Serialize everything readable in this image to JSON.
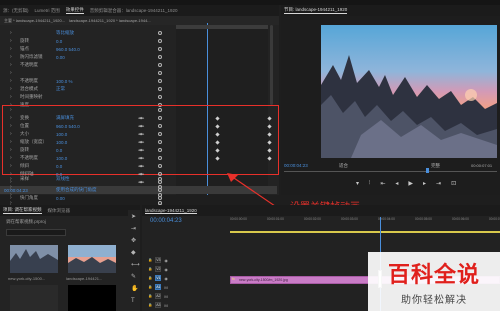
{
  "top_strip": {
    "text": "源：(无剪辑)"
  },
  "source_tabs": [
    "源：(无剪辑)",
    "Lumetri 范围",
    "效果控件",
    "音频剪辑混合器：landscape-1944211_1920"
  ],
  "effect_controls": {
    "clip_label": "主要 * landscape-1944211_1920...",
    "seq_label": "landscape-1944211_1920 * landscape-1944...",
    "rows_upper": [
      {
        "label": "",
        "value": "等比缩放",
        "checkbox": true
      },
      {
        "label": "旋转",
        "value": "0.0"
      },
      {
        "label": "锚点",
        "value": "960.0    540.0"
      },
      {
        "label": "防闪烁滤镜",
        "value": "0.00"
      },
      {
        "label": "不透明度",
        "value": ""
      },
      {
        "label": "",
        "value": ""
      },
      {
        "label": "不透明度",
        "value": "100.0 %"
      },
      {
        "label": "混合模式",
        "value": "正常"
      },
      {
        "label": "时间重映射",
        "value": ""
      },
      {
        "label": "速度",
        "value": ""
      }
    ],
    "rows_boxed": [
      {
        "label": "",
        "value": ""
      },
      {
        "label": "变换",
        "value": "满屏填充"
      },
      {
        "label": "位置",
        "value": "960.0    540.0"
      },
      {
        "label": "大小",
        "value": "100.0"
      },
      {
        "label": "缩放（宽度）",
        "value": "100.0"
      },
      {
        "label": "旋转",
        "value": "0.0"
      },
      {
        "label": "不透明度",
        "value": "100.0"
      },
      {
        "label": "倾斜",
        "value": "0.0"
      },
      {
        "label": "倾斜轴",
        "value": "0.0"
      },
      {
        "label": "",
        "value": ""
      },
      {
        "label": "",
        "value": "使用合成的快门角度"
      },
      {
        "label": "快门角度",
        "value": "0.00"
      },
      {
        "label": "",
        "value": ""
      },
      {
        "label": "",
        "value": ""
      },
      {
        "label": "",
        "value": ""
      }
    ],
    "rows_lower": [
      {
        "label": "采样",
        "value": "双线性"
      },
      {
        "label": "",
        "value": ""
      },
      {
        "label": "",
        "value": ""
      },
      {
        "label": "",
        "value": ""
      },
      {
        "label": "内容缩放",
        "value": ""
      }
    ],
    "timecode": "00:00:04:23"
  },
  "program_monitor": {
    "tab": "节目: landscape-1944211_1920",
    "timecode": "00:00:04:23",
    "fit": "适合",
    "quality": "完整",
    "duration": "00:00:07:01",
    "fraction": "1/2"
  },
  "annotation": {
    "text": "设置关键帧动画",
    "color": "#e8302a"
  },
  "project_panel": {
    "tabs": [
      "项目: 调在帮家视频",
      "媒体浏览器"
    ],
    "project_file": "调在帮家视频.prproj",
    "thumbs": [
      {
        "name": "new-york-city-1500...",
        "dur": "5:00"
      },
      {
        "name": "landscape-194421...",
        "dur": "5:00"
      },
      {
        "name": "",
        "dur": ""
      },
      {
        "name": "",
        "dur": ""
      }
    ]
  },
  "timeline": {
    "tab": "landscape-1944211_1920",
    "timecode": "00:00:04:23",
    "ruler": [
      "00:00:00:00",
      "00:00:01:00",
      "00:00:02:00",
      "00:00:03:00",
      "00:00:04:00",
      "00:00:05:00",
      "00:00:06:00",
      "00:00:07:00"
    ],
    "tracks": [
      "V3",
      "V2",
      "V1",
      "A1",
      "A2",
      "A3"
    ],
    "clip_label": "new-york-city-1500/m_1920.jpg",
    "clip2_label": "fx"
  },
  "watermark": {
    "title": "百科全说",
    "subtitle": "助你轻松解决"
  }
}
